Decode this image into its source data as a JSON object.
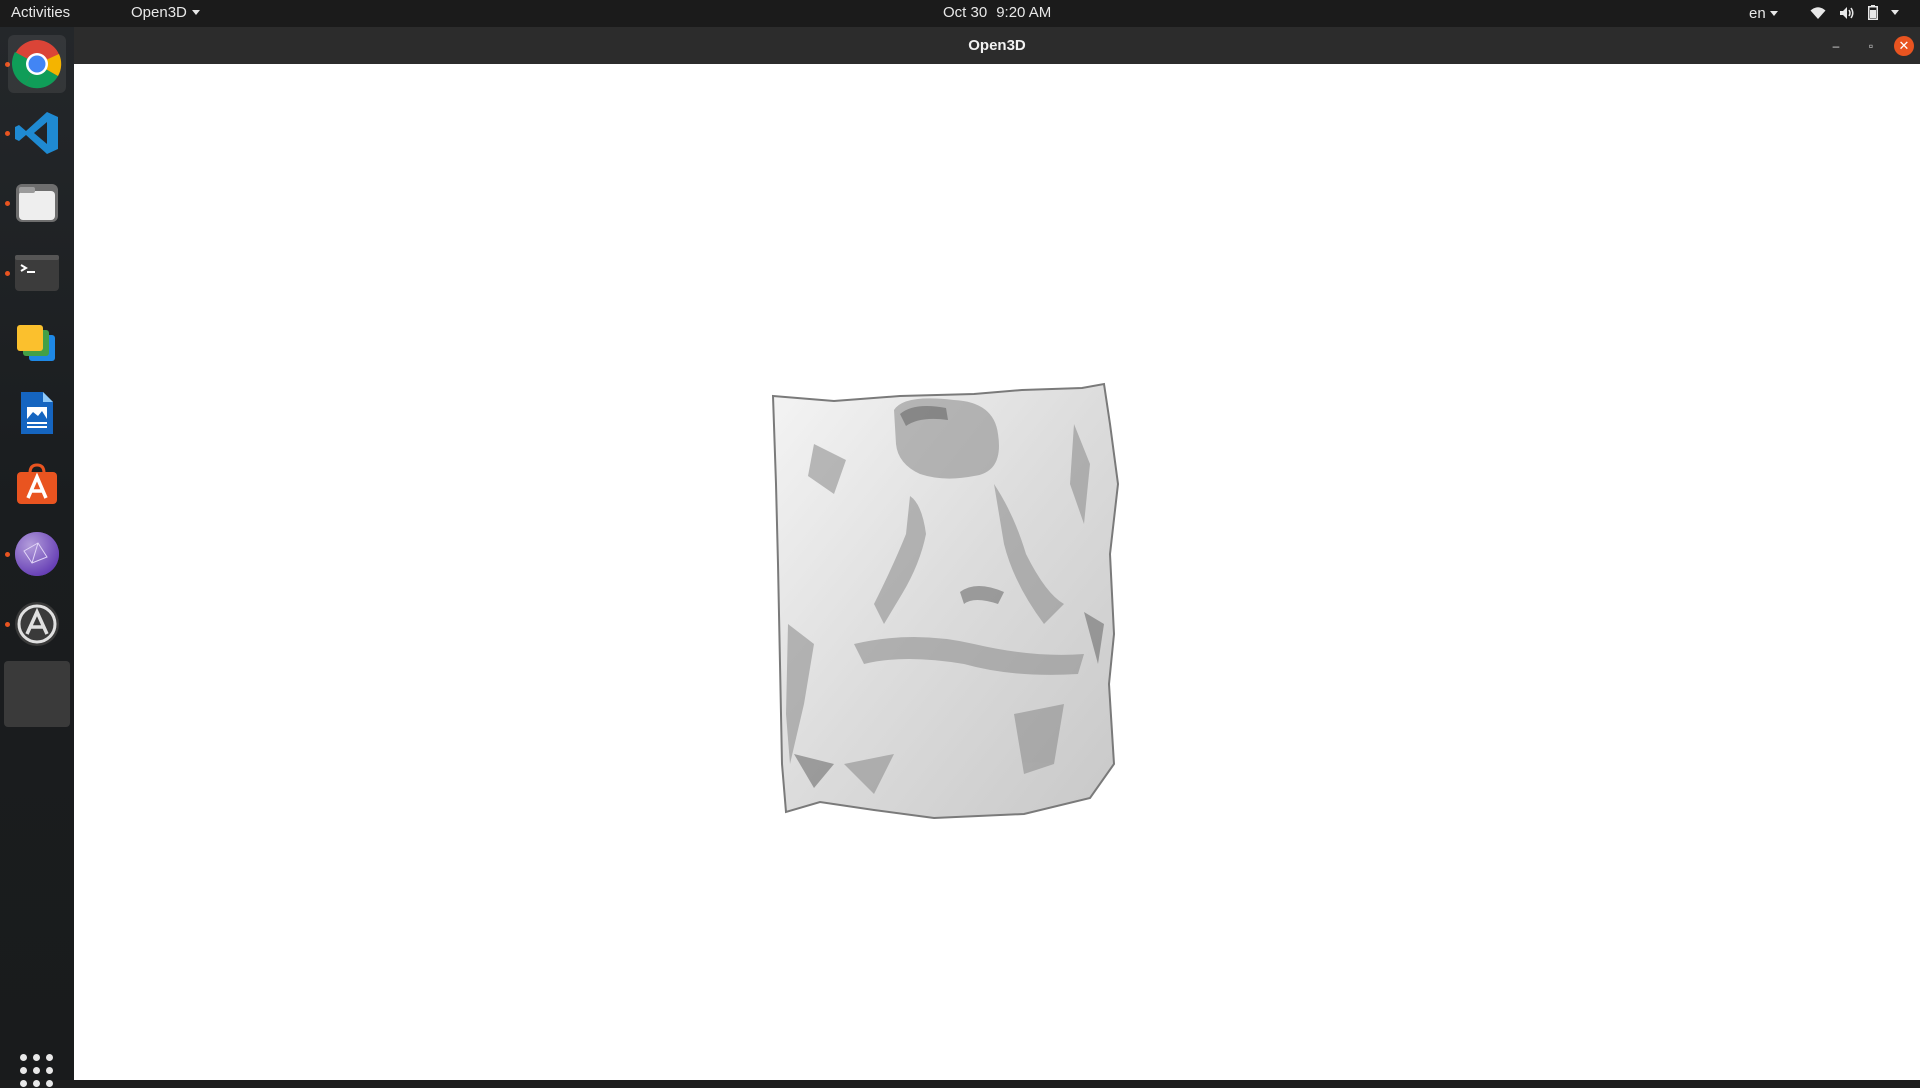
{
  "topbar": {
    "activities": "Activities",
    "app_menu": "Open3D",
    "date": "Oct 30",
    "time": "9:20 AM",
    "language": "en",
    "icons": [
      "wifi-icon",
      "volume-icon",
      "battery-icon",
      "system-menu-caret"
    ]
  },
  "dock": {
    "items": [
      {
        "name": "chrome",
        "running": true,
        "active": true
      },
      {
        "name": "vscode",
        "running": true
      },
      {
        "name": "files",
        "running": true
      },
      {
        "name": "terminal",
        "running": true
      },
      {
        "name": "slides-app",
        "running": false
      },
      {
        "name": "libreoffice-writer",
        "running": false
      },
      {
        "name": "ubuntu-software",
        "running": false
      },
      {
        "name": "network-app",
        "running": true
      },
      {
        "name": "software-updater",
        "running": true
      },
      {
        "name": "open3d-window",
        "running": true
      }
    ],
    "show_apps": "show-applications-icon"
  },
  "window": {
    "title": "Open3D",
    "controls": {
      "minimize": "–",
      "maximize": "▫",
      "close": "✕"
    },
    "background": "#ffffff"
  },
  "colors": {
    "topbar": "#1b1b1b",
    "titlebar": "#2c2c2c",
    "accent": "#e95420"
  }
}
